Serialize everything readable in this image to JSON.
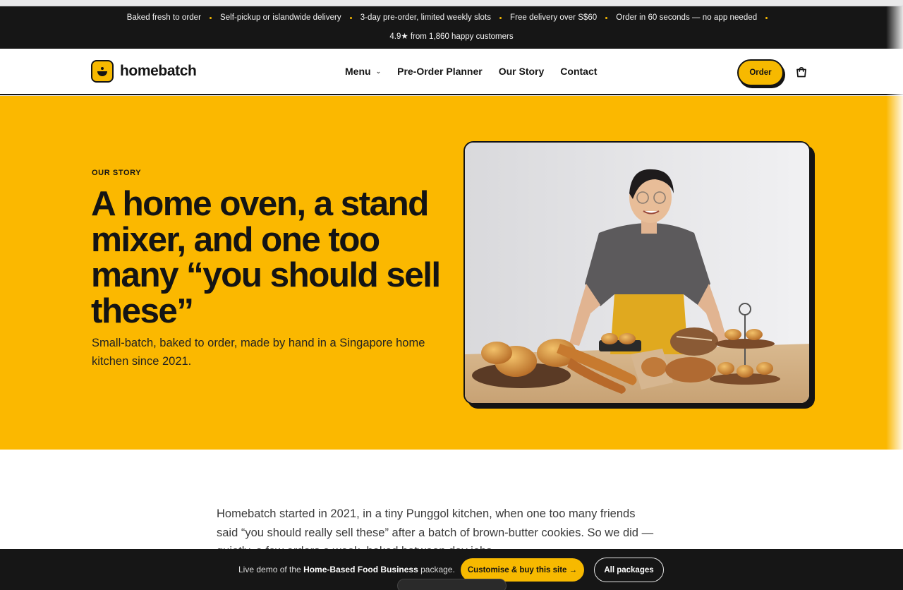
{
  "announcement": {
    "items": [
      "Baked fresh to order",
      "Self-pickup or islandwide delivery",
      "3-day pre-order, limited weekly slots",
      "Free delivery over S$60",
      "Order in 60 seconds — no app needed"
    ],
    "rating": "4.9★ from 1,860 happy customers"
  },
  "nav": {
    "brand": "homebatch",
    "links": [
      "Menu",
      "Pre-Order Planner",
      "Our Story",
      "Contact"
    ],
    "order_label": "Order"
  },
  "hero": {
    "eyebrow": "OUR STORY",
    "title": "A home oven, a stand mixer, and one too many “you should sell these”",
    "subtitle": "Small-batch, baked to order, made by hand in a Singapore home kitchen since 2021."
  },
  "story": {
    "paragraph": "Homebatch started in 2021, in a tiny Punggol kitchen, when one too many friends said “you should really sell these” after a batch of brown-butter cookies. So we did — quietly, a few orders a week, baked between day jobs."
  },
  "demo_bar": {
    "prefix": "Live demo of the ",
    "package_name": "Home-Based Food Business",
    "suffix": " package.",
    "cta_label": "Customise & buy this site →",
    "packages_label": "All packages"
  },
  "colors": {
    "brand_yellow": "#fbb800",
    "ink": "#141414"
  }
}
